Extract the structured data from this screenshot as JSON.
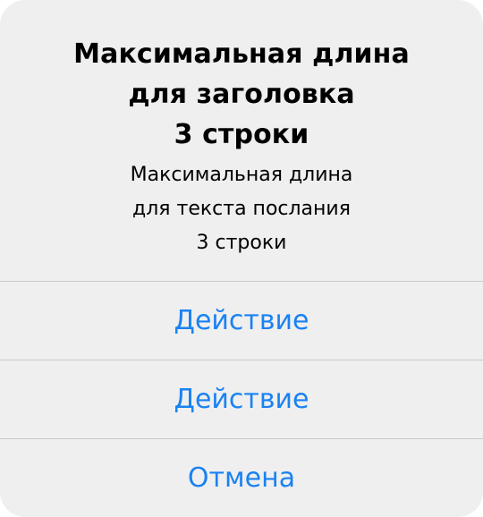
{
  "alert": {
    "title_lines": [
      "Максимальная длина",
      "для заголовка",
      "3 строки"
    ],
    "message_lines": [
      "Максимальная длина",
      "для текста послания",
      "3 строки"
    ],
    "actions": [
      {
        "label": "Действие"
      },
      {
        "label": "Действие"
      },
      {
        "label": "Отмена"
      }
    ],
    "colors": {
      "background": "#efefef",
      "action_text": "#1a82f2",
      "separator": "#c9c9c9",
      "text": "#000000"
    }
  }
}
